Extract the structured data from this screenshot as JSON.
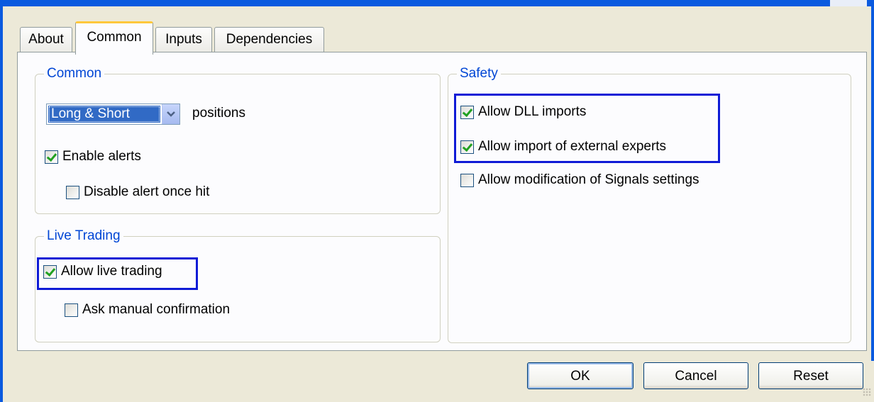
{
  "tabs": [
    {
      "label": "About",
      "active": false
    },
    {
      "label": "Common",
      "active": true
    },
    {
      "label": "Inputs",
      "active": false
    },
    {
      "label": "Dependencies",
      "active": false
    }
  ],
  "common_group": {
    "legend": "Common",
    "positions_select": {
      "value": "Long & Short",
      "label": "positions"
    },
    "enable_alerts": {
      "label": "Enable alerts",
      "checked": true
    },
    "disable_alert_once_hit": {
      "label": "Disable alert once hit",
      "checked": false
    }
  },
  "live_group": {
    "legend": "Live Trading",
    "allow_live_trading": {
      "label": "Allow live trading",
      "checked": true
    },
    "ask_manual_confirmation": {
      "label": "Ask manual confirmation",
      "checked": false
    }
  },
  "safety_group": {
    "legend": "Safety",
    "allow_dll_imports": {
      "label": "Allow DLL imports",
      "checked": true
    },
    "allow_import_external_experts": {
      "label": "Allow import of external experts",
      "checked": true
    },
    "allow_modification_signals": {
      "label": "Allow modification of Signals settings",
      "checked": false
    }
  },
  "buttons": {
    "ok": "OK",
    "cancel": "Cancel",
    "reset": "Reset"
  },
  "colors": {
    "highlight_box": "#0f1bd6",
    "group_legend": "#0046d5",
    "check_mark": "#21a121",
    "window_frame": "#0a5adf",
    "dialog_bg": "#ece9d8"
  }
}
